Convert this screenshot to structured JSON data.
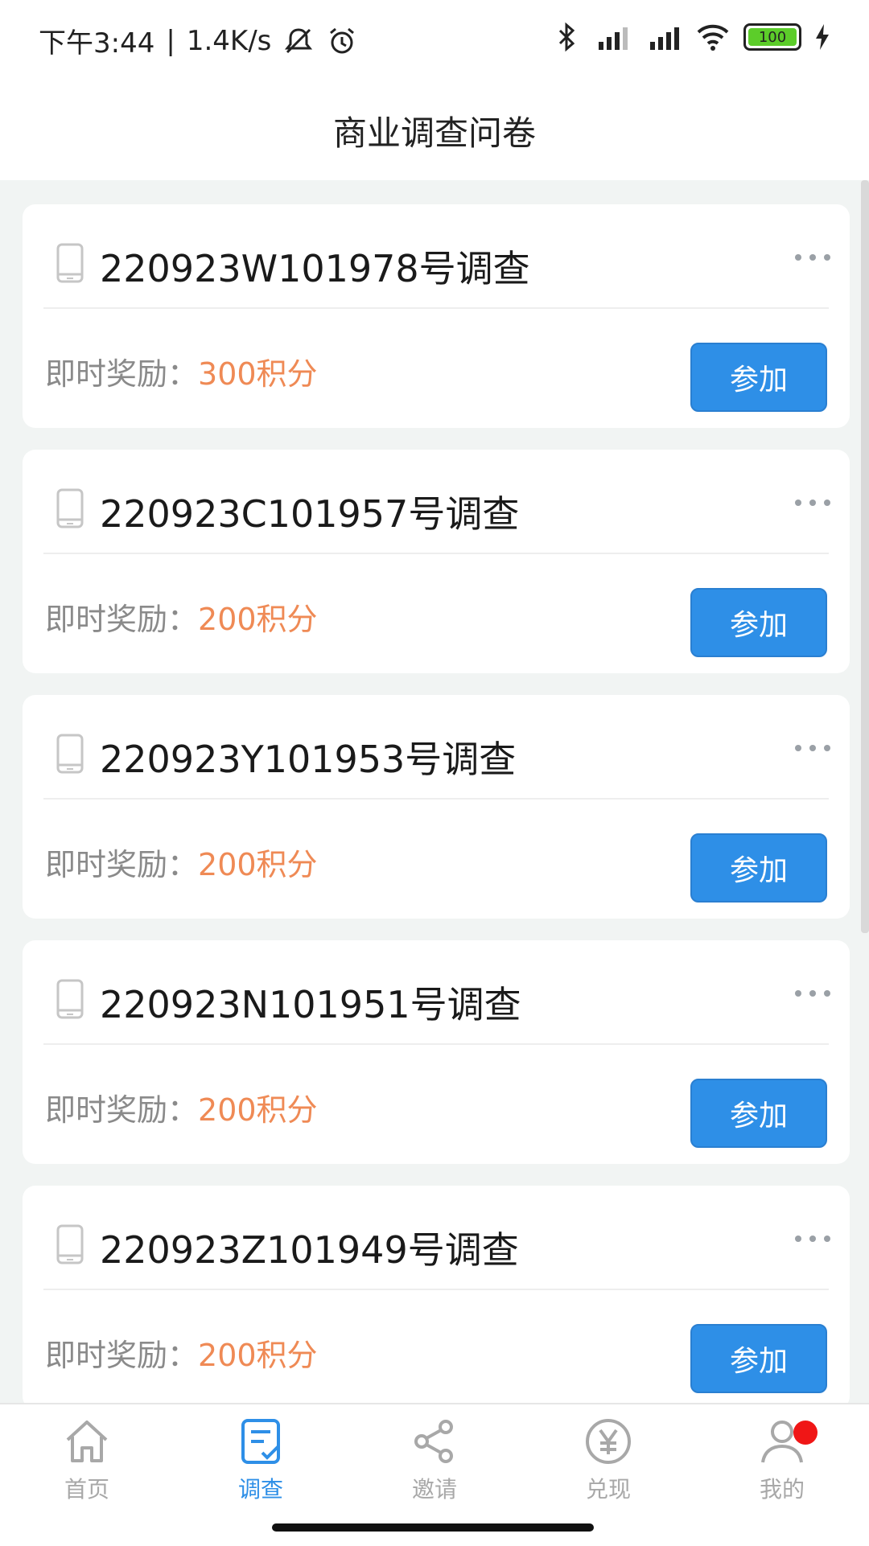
{
  "status_bar": {
    "time": "下午3:44",
    "separator": "|",
    "speed": "1.4K/s",
    "battery": "100"
  },
  "header": {
    "title": "商业调查问卷"
  },
  "surveys": [
    {
      "title": "220923W101978号调查",
      "reward_label": "即时奖励：",
      "reward_points": "300积分",
      "join_label": "参加"
    },
    {
      "title": "220923C101957号调查",
      "reward_label": "即时奖励：",
      "reward_points": "200积分",
      "join_label": "参加"
    },
    {
      "title": "220923Y101953号调查",
      "reward_label": "即时奖励：",
      "reward_points": "200积分",
      "join_label": "参加"
    },
    {
      "title": "220923N101951号调查",
      "reward_label": "即时奖励：",
      "reward_points": "200积分",
      "join_label": "参加"
    },
    {
      "title": "220923Z101949号调查",
      "reward_label": "即时奖励：",
      "reward_points": "200积分",
      "join_label": "参加"
    }
  ],
  "tabs": [
    {
      "label": "首页",
      "icon": "home-icon"
    },
    {
      "label": "调查",
      "icon": "survey-icon",
      "active": true
    },
    {
      "label": "邀请",
      "icon": "share-icon"
    },
    {
      "label": "兑现",
      "icon": "yen-icon"
    },
    {
      "label": "我的",
      "icon": "user-icon",
      "badge": true
    }
  ],
  "colors": {
    "accent": "#2e8fe7",
    "reward": "#ef8a55",
    "badge": "#f01616",
    "background": "#f1f4f3"
  }
}
